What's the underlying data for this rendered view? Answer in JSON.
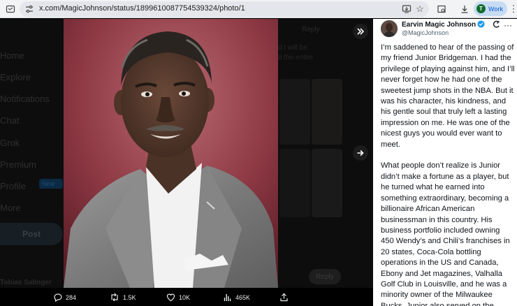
{
  "browser": {
    "url": "x.com/MagicJohnson/status/1899610087754539324/photo/1",
    "profile_initial": "T",
    "profile_label": "Work"
  },
  "background": {
    "nav": [
      "Home",
      "Explore",
      "Notifications",
      "Chat",
      "Grok",
      "Premium",
      "Profile",
      "More"
    ],
    "premium_badge": "New",
    "post_button": "Post",
    "reply_top": "Reply",
    "text_lines": [
      "d I will be",
      "d the entire"
    ],
    "user_name": "Tobias Salinger",
    "reply_button": "Reply"
  },
  "stats": {
    "replies": "284",
    "reposts": "1.5K",
    "likes": "10K",
    "views": "465K"
  },
  "tweet": {
    "display_name": "Earvin Magic Johnson",
    "handle": "@MagicJohnson",
    "paragraph1": "I’m saddened to hear of the passing of my friend Junior Bridgeman. I had the privilege of playing against him, and I’ll never forget how he had one of the sweetest jump shots in the NBA. But it was his character, his kindness, and his gentle soul that truly left a lasting impression on me. He was one of the nicest guys you would ever want to meet.",
    "paragraph2": "What people don’t realize is Junior didn’t make a fortune as a player, but he turned what he earned into something extraordinary, becoming a billionaire African American businessman in this country. His business portfolio included owning 450 Wendy’s and Chili’s franchises in 20 states, Coca-Cola bottling operations in the US and Canada, Ebony and Jet magazines, Valhalla Golf Club in Louisville, and he was a minority owner of the Milwaukee Bucks. Junior also served on the"
  },
  "colors": {
    "accent": "#1d9bf0",
    "photo_backdrop": "#8d3340"
  }
}
